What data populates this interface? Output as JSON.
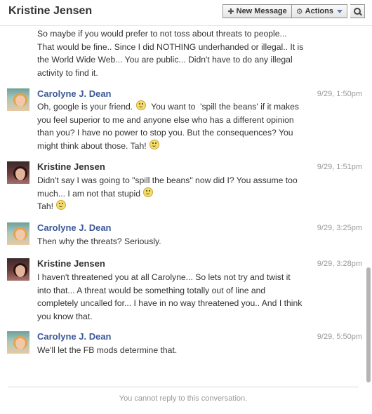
{
  "header": {
    "title": "Kristine Jensen",
    "new_message_label": "New Message",
    "new_message_icon": "plus-icon",
    "actions_label": "Actions",
    "actions_icon": "gear-icon",
    "search_icon": "search-icon"
  },
  "messages": [
    {
      "author": "",
      "time": "",
      "lines": [
        "So maybe if you would prefer to not toss about threats to people...",
        "That would be fine.. Since I did NOTHING underhanded or illegal.. It is",
        "the World Wide Web... You are public... Didn't have to do any illegal",
        "activity to find it."
      ]
    },
    {
      "author": "Carolyne J. Dean",
      "time": "9/29, 1:50pm",
      "lines": [
        "Oh, google is your friend.",
        "  You want to  'spill the beans' if it makes",
        "you feel superior to me and anyone else who has a different opinion",
        "than you? I have no power to stop you. But the consequences? You",
        "might think about those. Tah!"
      ]
    },
    {
      "author": "Kristine Jensen",
      "time": "9/29, 1:51pm",
      "lines": [
        "Didn't say I was going to \"spill the beans\" now did I? You assume too",
        "much... I am not that stupid",
        "Tah!"
      ]
    },
    {
      "author": "Carolyne J. Dean",
      "time": "9/29, 3:25pm",
      "lines": [
        "Then why the threats? Seriously."
      ]
    },
    {
      "author": "Kristine Jensen",
      "time": "9/29, 3:28pm",
      "lines": [
        "I haven't threatened you at all Carolyne... So lets not try and twist it",
        "into that... A threat would be something totally out of line and",
        "completely uncalled for... I have in no way threatened you.. And I think",
        "you know that."
      ]
    },
    {
      "author": "Carolyne J. Dean",
      "time": "9/29, 5:50pm",
      "lines": [
        "We'll let the FB mods determine that."
      ]
    }
  ],
  "footer": {
    "notice": "You cannot reply to this conversation."
  }
}
